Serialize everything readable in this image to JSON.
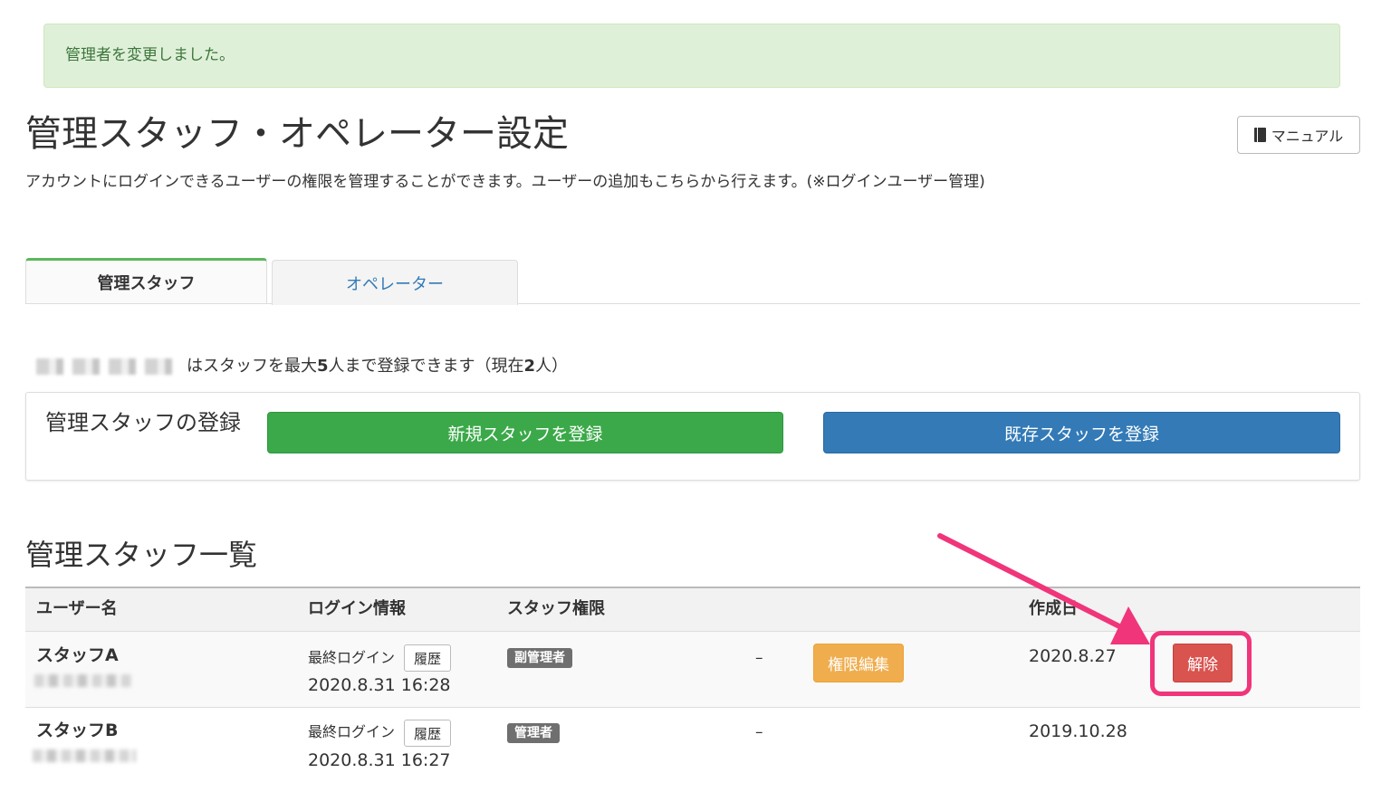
{
  "alert": {
    "message": "管理者を変更しました。"
  },
  "header": {
    "title": "管理スタッフ・オペレーター設定",
    "description": "アカウントにログインできるユーザーの権限を管理することができます。ユーザーの追加もこちらから行えます。(※ログインユーザー管理)",
    "manual_label": "マニュアル"
  },
  "tabs": [
    {
      "label": "管理スタッフ",
      "active": true
    },
    {
      "label": "オペレーター",
      "active": false
    }
  ],
  "limit": {
    "prefix": "はスタッフを最大 ",
    "max": "5",
    "middle": "人まで登録できます（現在 ",
    "current": "2",
    "suffix": "人）"
  },
  "register": {
    "label": "管理スタッフの登録",
    "new_button": "新規スタッフを登録",
    "existing_button": "既存スタッフを登録"
  },
  "list": {
    "title": "管理スタッフ一覧",
    "columns": [
      "ユーザー名",
      "ログイン情報",
      "スタッフ権限",
      "作成日"
    ],
    "rows": [
      {
        "name": "スタッフA",
        "last_login_label": "最終ログイン",
        "history_label": "履歴",
        "last_login_time": "2020.8.31 16:28",
        "role": "副管理者",
        "extra": "–",
        "edit_label": "権限編集",
        "created": "2020.8.27",
        "remove_label": "解除"
      },
      {
        "name": "スタッフB",
        "last_login_label": "最終ログイン",
        "history_label": "履歴",
        "last_login_time": "2020.8.31 16:27",
        "role": "管理者",
        "extra": "–",
        "created": "2019.10.28"
      }
    ]
  },
  "colors": {
    "alert_bg": "#dff0d8",
    "green": "#3ba949",
    "blue": "#337ab7",
    "orange": "#f0ad4e",
    "red": "#d9534f",
    "annotation": "#f0357a"
  }
}
